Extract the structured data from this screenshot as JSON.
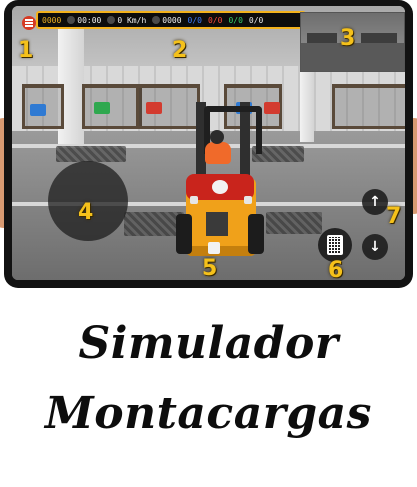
{
  "hud": {
    "left_counter": "0000",
    "time": "00:00",
    "speed": "0 Km/h",
    "mid_counter": "0000",
    "score_blue": "0/0",
    "score_red": "0/0",
    "score_green": "0/0",
    "score_white": "0/0"
  },
  "labels": {
    "n1": "1",
    "n2": "2",
    "n3": "3",
    "n4": "4",
    "n5": "5",
    "n6": "6",
    "n7": "7"
  },
  "title": {
    "line1": "Simulador",
    "line2": "Montacargas"
  },
  "buttons": {
    "up_arrow": "↑",
    "down_arrow": "↓"
  },
  "colors": {
    "hud_border": "#f3b21c",
    "label_yellow": "#f5c11a",
    "forklift_body": "#f0a11a",
    "tank_red": "#c9241c",
    "menu_red": "#d63a23"
  },
  "icons": {
    "menu": "hamburger-menu-icon",
    "joystick": "joystick",
    "cargo": "grid-icon",
    "lift_up": "arrow-up-icon",
    "lift_down": "arrow-down-icon"
  }
}
